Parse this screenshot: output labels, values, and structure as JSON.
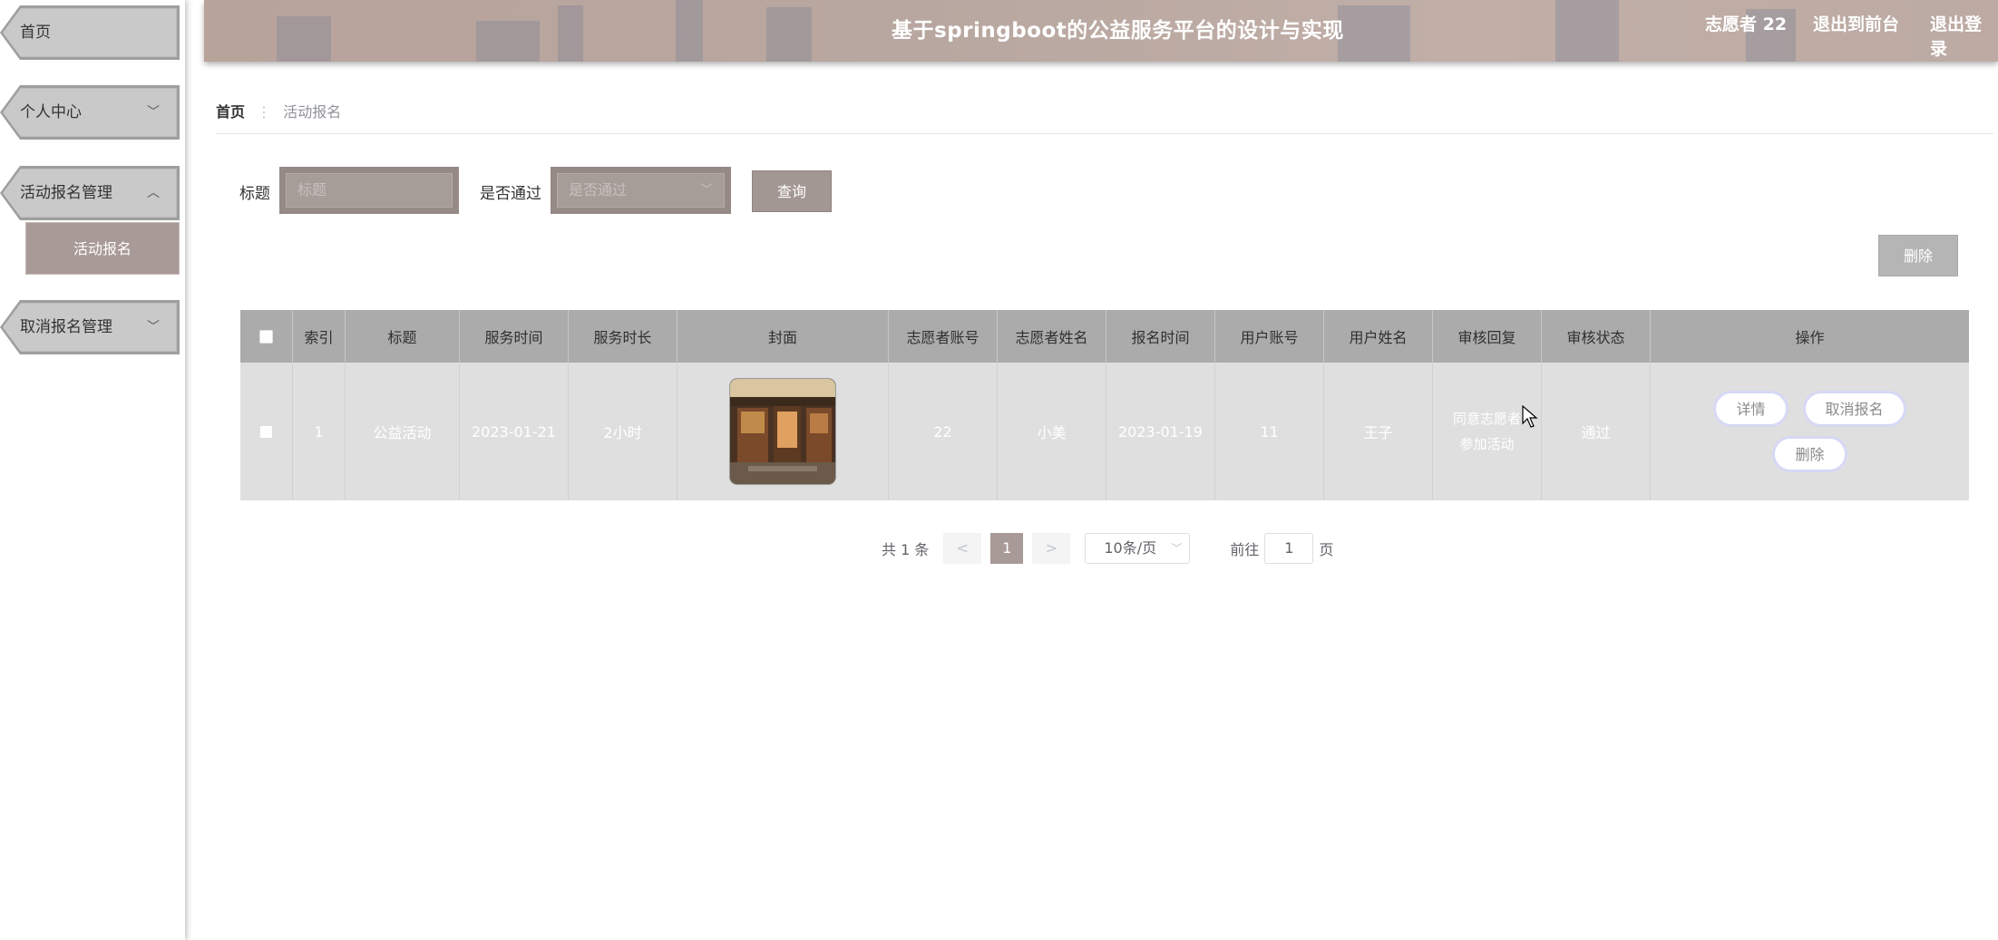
{
  "sidebar": {
    "items": [
      {
        "label": "首页"
      },
      {
        "label": "个人中心",
        "chevron": "chevron-down"
      },
      {
        "label": "活动报名管理",
        "chevron": "chevron-up"
      },
      {
        "label": "取消报名管理",
        "chevron": "chevron-down"
      }
    ],
    "submenu": {
      "label": "活动报名"
    }
  },
  "header": {
    "title": "基于springboot的公益服务平台的设计与实现",
    "user": "志愿者 22",
    "to_front": "退出到前台",
    "logout": "退出登录"
  },
  "breadcrumb": {
    "home": "首页",
    "separator": "⋮",
    "current": "活动报名"
  },
  "search": {
    "title_label": "标题",
    "title_placeholder": "标题",
    "pass_label": "是否通过",
    "pass_placeholder": "是否通过",
    "query_button": "查询"
  },
  "toolbar": {
    "delete_button": "删除"
  },
  "table": {
    "columns": [
      "索引",
      "标题",
      "服务时间",
      "服务时长",
      "封面",
      "志愿者账号",
      "志愿者姓名",
      "报名时间",
      "用户账号",
      "用户姓名",
      "审核回复",
      "审核状态",
      "操作"
    ],
    "rows": [
      {
        "index": "1",
        "title": "公益活动",
        "service_time": "2023-01-21",
        "duration": "2小时",
        "volunteer_account": "22",
        "volunteer_name": "小美",
        "signup_time": "2023-01-19",
        "user_account": "11",
        "user_name": "王子",
        "reply_line1": "同意志愿者",
        "reply_line2": "参加活动",
        "status": "通过",
        "actions": {
          "detail": "详情",
          "cancel": "取消报名",
          "delete": "删除"
        }
      }
    ]
  },
  "pagination": {
    "total": "共 1 条",
    "prev": "<",
    "page": "1",
    "next": ">",
    "page_size": "10条/页",
    "goto_label": "前往",
    "goto_value": "1",
    "page_unit": "页"
  },
  "colors": {
    "accent": "#a89a96",
    "header": "#b8a39b",
    "table_head": "#ababab",
    "table_row": "#dfdfdf"
  }
}
